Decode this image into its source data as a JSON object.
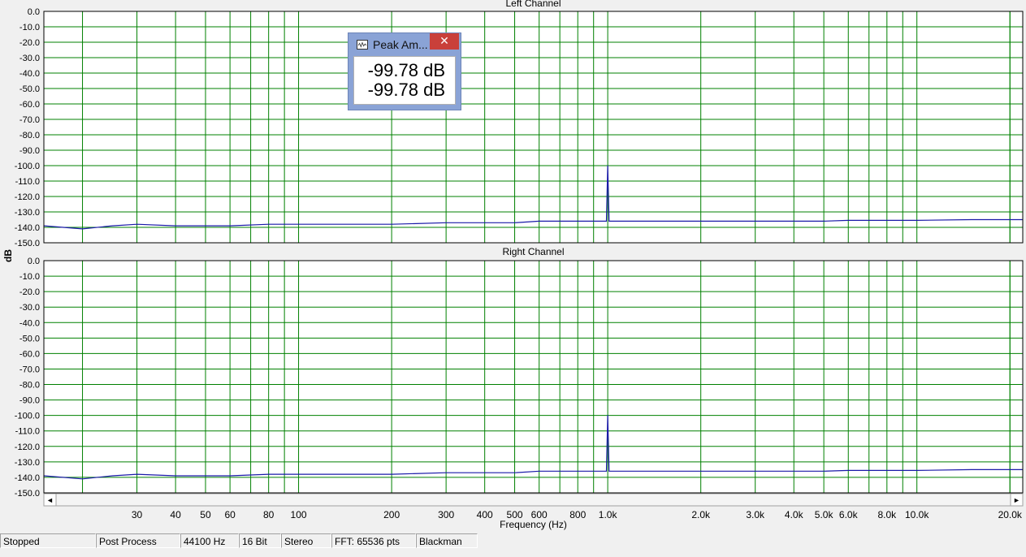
{
  "colors": {
    "plot_background": "#ffffff",
    "grid": "#008000",
    "trace": "#1a1aa8",
    "window_bg": "#f0f0f0"
  },
  "chart_data": [
    {
      "type": "line",
      "title": "Left Channel",
      "xlabel": "Frequency (Hz)",
      "ylabel": "dB",
      "xscale": "log",
      "xlim": [
        15,
        22000
      ],
      "ylim": [
        -150,
        0
      ],
      "y_ticks": [
        "0.0",
        "-10.0",
        "-20.0",
        "-30.0",
        "-40.0",
        "-50.0",
        "-60.0",
        "-70.0",
        "-80.0",
        "-90.0",
        "-100.0",
        "-110.0",
        "-120.0",
        "-130.0",
        "-140.0",
        "-150.0"
      ],
      "x_tick_labels": [
        "30",
        "40",
        "50",
        "60",
        "80",
        "100",
        "200",
        "300",
        "400",
        "500",
        "600",
        "800",
        "1.0k",
        "2.0k",
        "3.0k",
        "4.0k",
        "5.0k",
        "6.0k",
        "8.0k",
        "10.0k",
        "20.0k"
      ],
      "grid": true,
      "series": [
        {
          "x": [
            15,
            20,
            25,
            30,
            40,
            50,
            60,
            80,
            100,
            150,
            200,
            300,
            400,
            500,
            600,
            800,
            990,
            1000,
            1010,
            1500,
            2000,
            3000,
            4000,
            5000,
            6000,
            8000,
            10000,
            15000,
            20000,
            22000
          ],
          "y": [
            -139,
            -141,
            -139,
            -138,
            -139,
            -139,
            -139,
            -138,
            -138,
            -138,
            -138,
            -137,
            -137,
            -137,
            -136,
            -136,
            -136,
            -99.78,
            -136,
            -136,
            -136,
            -136,
            -136,
            -136,
            -135.5,
            -135.5,
            -135.5,
            -135,
            -135,
            -135
          ]
        }
      ]
    },
    {
      "type": "line",
      "title": "Right Channel",
      "xlabel": "Frequency (Hz)",
      "ylabel": "dB",
      "xscale": "log",
      "xlim": [
        15,
        22000
      ],
      "ylim": [
        -150,
        0
      ],
      "y_ticks": [
        "0.0",
        "-10.0",
        "-20.0",
        "-30.0",
        "-40.0",
        "-50.0",
        "-60.0",
        "-70.0",
        "-80.0",
        "-90.0",
        "-100.0",
        "-110.0",
        "-120.0",
        "-130.0",
        "-140.0",
        "-150.0"
      ],
      "x_tick_labels": [
        "30",
        "40",
        "50",
        "60",
        "80",
        "100",
        "200",
        "300",
        "400",
        "500",
        "600",
        "800",
        "1.0k",
        "2.0k",
        "3.0k",
        "4.0k",
        "5.0k",
        "6.0k",
        "8.0k",
        "10.0k",
        "20.0k"
      ],
      "grid": true,
      "series": [
        {
          "x": [
            15,
            20,
            25,
            30,
            40,
            50,
            60,
            80,
            100,
            150,
            200,
            300,
            400,
            500,
            600,
            800,
            990,
            1000,
            1010,
            1500,
            2000,
            3000,
            4000,
            5000,
            6000,
            8000,
            10000,
            15000,
            20000,
            22000
          ],
          "y": [
            -139,
            -141,
            -139,
            -138,
            -139,
            -139,
            -139,
            -138,
            -138,
            -138,
            -138,
            -137,
            -137,
            -137,
            -136,
            -136,
            -136,
            -99.78,
            -136,
            -136,
            -136,
            -136,
            -136,
            -136,
            -135.5,
            -135.5,
            -135.5,
            -135,
            -135,
            -135
          ]
        }
      ]
    }
  ],
  "y_axis_label": "dB",
  "x_axis_label": "Frequency (Hz)",
  "scrollbar": {
    "left_arrow": "◄",
    "right_arrow": "►"
  },
  "peak_window": {
    "title": "Peak Am...",
    "close_label": "✕",
    "icon": "waveform-icon",
    "left_value": "-99.78 dB",
    "right_value": "-99.78 dB"
  },
  "status_bar": {
    "state": "Stopped",
    "mode": "Post Process",
    "sample_rate": "44100 Hz",
    "bit_depth": "16 Bit",
    "channels": "Stereo",
    "fft": "FFT: 65536 pts",
    "window": "Blackman"
  }
}
